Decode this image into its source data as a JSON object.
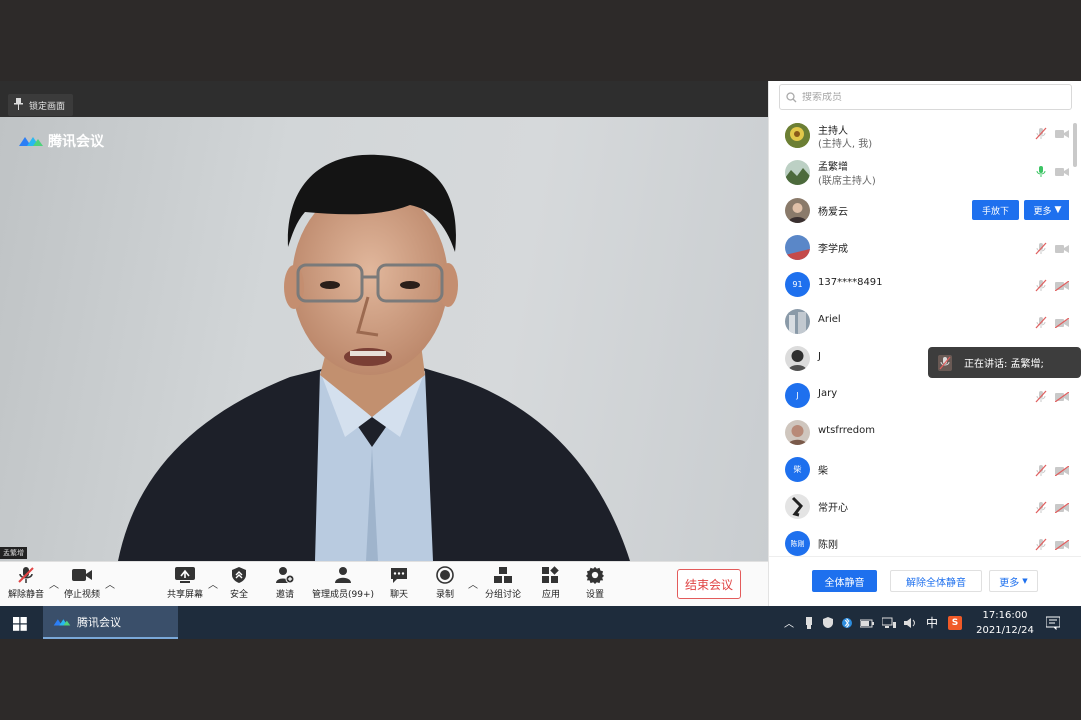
{
  "video": {
    "lock_label": "锁定画面",
    "logo_text": "腾讯会议",
    "speaker_tag": "孟繁增"
  },
  "toolbar": {
    "unmute": "解除静音",
    "stop_video": "停止视频",
    "share_screen": "共享屏幕",
    "security": "安全",
    "invite": "邀请",
    "manage_members": "管理成员(99+)",
    "chat": "聊天",
    "record": "录制",
    "breakout": "分组讨论",
    "apps": "应用",
    "settings": "设置",
    "end_meeting": "结束会议"
  },
  "panel": {
    "search_placeholder": "搜索成员",
    "members": [
      {
        "name": "主持人",
        "role": "(主持人, 我)",
        "avatar": "photo",
        "mic": "muted"
      },
      {
        "name": "孟繁增",
        "role": "(联席主持人)",
        "avatar": "photo",
        "mic": "active"
      },
      {
        "name": "杨爱云",
        "role": "",
        "avatar": "photo",
        "actions": [
          "手放下",
          "更多"
        ]
      },
      {
        "name": "李学成",
        "role": "",
        "avatar": "photo",
        "mic": "muted"
      },
      {
        "name": "137****8491",
        "role": "",
        "avatar": "91",
        "mic": "muted"
      },
      {
        "name": "Ariel",
        "role": "",
        "avatar": "photo",
        "mic": "muted"
      },
      {
        "name": "J",
        "role": "",
        "avatar": "photo",
        "mic": "muted"
      },
      {
        "name": "Jary",
        "role": "",
        "avatar": "J",
        "mic": "muted"
      },
      {
        "name": "wtsfrredom",
        "role": "",
        "avatar": "photo",
        "mic": "muted"
      },
      {
        "name": "柴",
        "role": "",
        "avatar": "柴",
        "mic": "muted"
      },
      {
        "name": "常开心",
        "role": "",
        "avatar": "photo",
        "mic": "muted"
      },
      {
        "name": "陈刚",
        "role": "",
        "avatar": "陈刚",
        "mic": "muted"
      }
    ],
    "mute_all": "全体静音",
    "unmute_all": "解除全体静音",
    "more": "更多"
  },
  "toast": {
    "speaking": "正在讲话: 孟繁增;"
  },
  "taskbar": {
    "app_label": "腾讯会议",
    "ime": "中",
    "time": "17:16:00",
    "date": "2021/12/24"
  },
  "colors": {
    "accent": "#1e70ee",
    "danger": "#e04444",
    "taskbar": "#1e2c3c"
  }
}
